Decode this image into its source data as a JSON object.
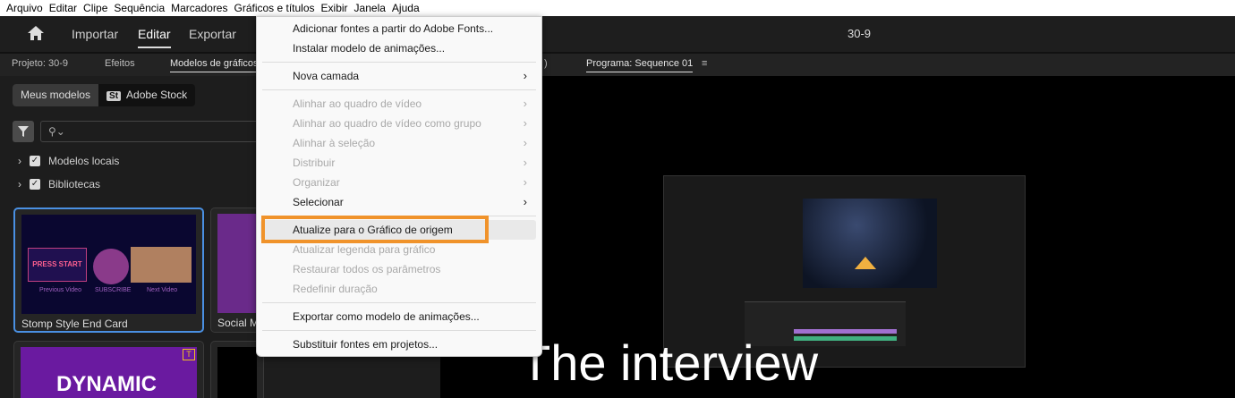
{
  "menubar": [
    "Arquivo",
    "Editar",
    "Clipe",
    "Sequência",
    "Marcadores",
    "Gráficos e títulos",
    "Exibir",
    "Janela",
    "Ajuda"
  ],
  "topbar": {
    "import": "Importar",
    "edit": "Editar",
    "export": "Exportar",
    "title": "30-9"
  },
  "tabs": {
    "project": "Projeto: 30-9",
    "effects": "Efeitos",
    "graphics": "Modelos de gráficos",
    "partial": ")",
    "program": "Programa: Sequence 01",
    "program_menu": "≡"
  },
  "panel": {
    "my_templates": "Meus modelos",
    "stock_badge": "St",
    "adobe_stock": "Adobe Stock",
    "search_icon": "⚲⌄",
    "tree": [
      "Modelos locais",
      "Bibliotecas"
    ],
    "cards": [
      {
        "label": "Stomp Style End Card",
        "thumb_texts": [
          "PRESS START",
          "Previous Video",
          "SUBSCRIBE",
          "Next Video"
        ]
      },
      {
        "label": "Social M"
      },
      {
        "label": "",
        "thumb_text": "DYNAMIC"
      },
      {
        "label": ""
      }
    ]
  },
  "program": {
    "caption": "The interview"
  },
  "dropdown": {
    "items": [
      {
        "label": "Adicionar fontes a partir do Adobe Fonts..."
      },
      {
        "label": "Instalar modelo de animações..."
      },
      {
        "sep": true
      },
      {
        "label": "Nova camada",
        "sub": true
      },
      {
        "sep": true
      },
      {
        "label": "Alinhar ao quadro de vídeo",
        "sub": true,
        "disabled": true
      },
      {
        "label": "Alinhar ao quadro de vídeo como grupo",
        "sub": true,
        "disabled": true
      },
      {
        "label": "Alinhar à seleção",
        "sub": true,
        "disabled": true
      },
      {
        "label": "Distribuir",
        "sub": true,
        "disabled": true
      },
      {
        "label": "Organizar",
        "sub": true,
        "disabled": true
      },
      {
        "label": "Selecionar",
        "sub": true
      },
      {
        "sep": true
      },
      {
        "label": "Atualize para o Gráfico de origem",
        "highlighted": true
      },
      {
        "label": "Atualizar legenda para gráfico",
        "disabled": true
      },
      {
        "label": "Restaurar todos os parâmetros",
        "disabled": true
      },
      {
        "label": "Redefinir duração",
        "disabled": true
      },
      {
        "sep": true
      },
      {
        "label": "Exportar como modelo de animações..."
      },
      {
        "sep": true
      },
      {
        "label": "Substituir fontes em projetos..."
      }
    ]
  },
  "colors": {
    "highlight_box": "#f0932b",
    "selected_card": "#4a90e2"
  }
}
